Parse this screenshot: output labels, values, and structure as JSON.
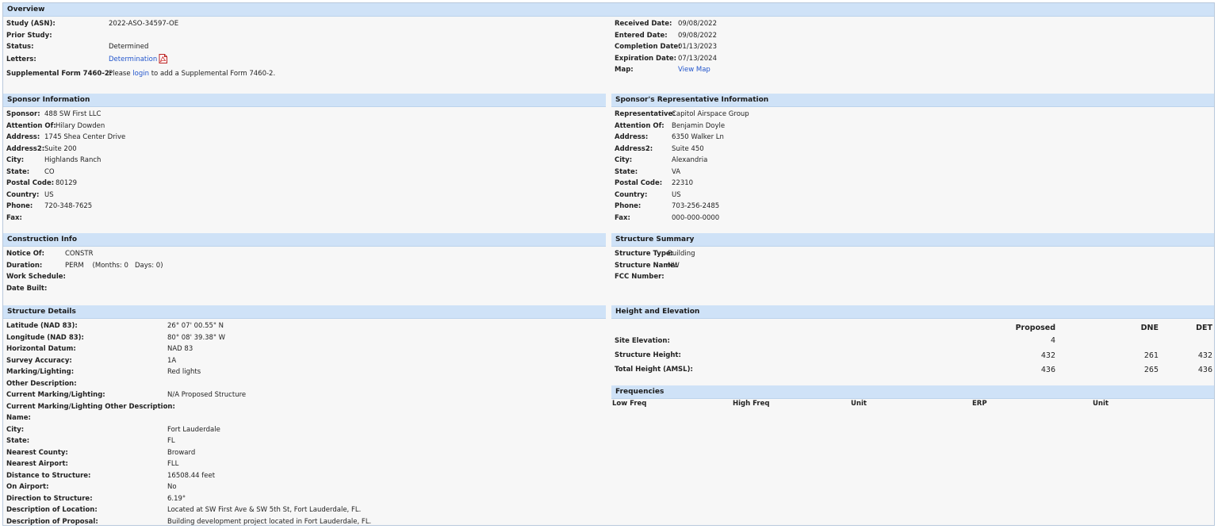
{
  "overview": {
    "title": "Overview",
    "study_label": "Study (ASN):",
    "study_value": "2022-ASO-34597-OE",
    "prior_label": "Prior Study:",
    "prior_value": "",
    "status_label": "Status:",
    "status_value": "Determined",
    "letters_label": "Letters:",
    "letters_link": "Determination",
    "supp_label": "Supplemental Form 7460-2:",
    "supp_pre": "Please ",
    "supp_link": "login",
    "supp_post": " to add a Supplemental Form 7460-2.",
    "received_label": "Received Date:",
    "received_value": "09/08/2022",
    "entered_label": "Entered Date:",
    "entered_value": "09/08/2022",
    "completion_label": "Completion Date:",
    "completion_value": "01/13/2023",
    "expiration_label": "Expiration Date:",
    "expiration_value": "07/13/2024",
    "map_label": "Map:",
    "map_link": "View Map"
  },
  "sponsor": {
    "title": "Sponsor Information",
    "rows": [
      {
        "label": "Sponsor:",
        "value": "488 SW First LLC"
      },
      {
        "label": "Attention Of:",
        "value": "Hilary Dowden"
      },
      {
        "label": "Address:",
        "value": "1745 Shea Center Drive"
      },
      {
        "label": "Address2:",
        "value": "Suite 200"
      },
      {
        "label": "City:",
        "value": "Highlands Ranch"
      },
      {
        "label": "State:",
        "value": "CO"
      },
      {
        "label": "Postal Code:",
        "value": "80129"
      },
      {
        "label": "Country:",
        "value": "US"
      },
      {
        "label": "Phone:",
        "value": "720-348-7625"
      },
      {
        "label": "Fax:",
        "value": ""
      }
    ]
  },
  "representative": {
    "title": "Sponsor's Representative Information",
    "rows": [
      {
        "label": "Representative:",
        "value": "Capitol Airspace Group"
      },
      {
        "label": "Attention Of:",
        "value": "Benjamin Doyle"
      },
      {
        "label": "Address:",
        "value": "6350 Walker Ln"
      },
      {
        "label": "Address2:",
        "value": "Suite 450"
      },
      {
        "label": "City:",
        "value": "Alexandria"
      },
      {
        "label": "State:",
        "value": "VA"
      },
      {
        "label": "Postal Code:",
        "value": "22310"
      },
      {
        "label": "Country:",
        "value": "US"
      },
      {
        "label": "Phone:",
        "value": "703-256-2485"
      },
      {
        "label": "Fax:",
        "value": "000-000-0000"
      }
    ]
  },
  "construction": {
    "title": "Construction Info",
    "rows": [
      {
        "label": "Notice Of:",
        "value": "CONSTR"
      },
      {
        "label": "Duration:",
        "value": "PERM    (Months: 0   Days: 0)"
      },
      {
        "label": "Work Schedule:",
        "value": ""
      },
      {
        "label": "Date Built:",
        "value": ""
      }
    ]
  },
  "summary": {
    "title": "Structure Summary",
    "rows": [
      {
        "label": "Structure Type:",
        "value": "Building"
      },
      {
        "label": "Structure Name:",
        "value": "NW"
      },
      {
        "label": "FCC Number:",
        "value": ""
      }
    ]
  },
  "details": {
    "title": "Structure Details",
    "rows": [
      {
        "label": "Latitude (NAD 83):",
        "value": "26° 07' 00.55\" N"
      },
      {
        "label": "Longitude (NAD 83):",
        "value": "80° 08' 39.38\" W"
      },
      {
        "label": "Horizontal Datum:",
        "value": "NAD 83"
      },
      {
        "label": "Survey Accuracy:",
        "value": "1A"
      },
      {
        "label": "Marking/Lighting:",
        "value": "Red lights"
      },
      {
        "label": "Other Description:",
        "value": ""
      },
      {
        "label": "Current Marking/Lighting:",
        "value": "N/A Proposed Structure"
      },
      {
        "label": "Current Marking/Lighting Other Description:",
        "value": ""
      },
      {
        "label": "Name:",
        "value": ""
      },
      {
        "label": "City:",
        "value": "Fort Lauderdale"
      },
      {
        "label": "State:",
        "value": "FL"
      },
      {
        "label": "Nearest County:",
        "value": "Broward"
      },
      {
        "label": "Nearest Airport:",
        "value": "FLL"
      },
      {
        "label": "Distance to Structure:",
        "value": "16508.44 feet"
      },
      {
        "label": "On Airport:",
        "value": "No"
      },
      {
        "label": "Direction to Structure:",
        "value": "6.19°"
      },
      {
        "label": "Description of Location:",
        "value": "Located at SW First Ave & SW 5th St, Fort Lauderdale, FL."
      },
      {
        "label": "Description of Proposal:",
        "value": "Building development project located in Fort Lauderdale, FL."
      }
    ]
  },
  "height": {
    "title": "Height and Elevation",
    "columns": [
      "Proposed",
      "DNE",
      "DET"
    ],
    "rows": [
      {
        "label": "Site Elevation:",
        "values": [
          "4",
          "",
          ""
        ]
      },
      {
        "label": "Structure Height:",
        "values": [
          "432",
          "261",
          "432"
        ]
      },
      {
        "label": "Total Height (AMSL):",
        "values": [
          "436",
          "265",
          "436"
        ]
      }
    ]
  },
  "frequencies": {
    "title": "Frequencies",
    "columns": [
      "Low Freq",
      "High Freq",
      "Unit",
      "ERP",
      "Unit"
    ]
  },
  "colors": {
    "header_bg": "#cfe2f7",
    "link": "#2255cc",
    "panel_bg": "#f7f7f7"
  },
  "icons": {
    "pdf": "pdf-icon"
  }
}
